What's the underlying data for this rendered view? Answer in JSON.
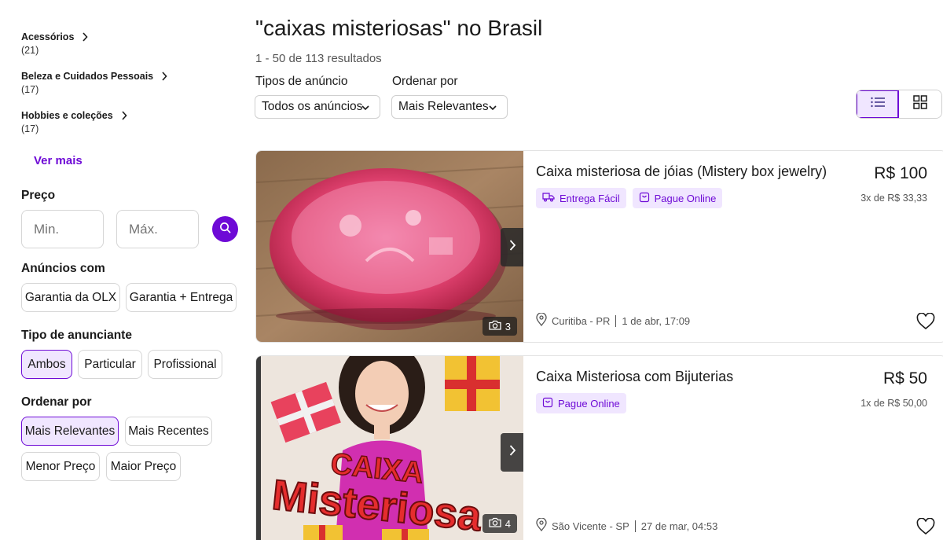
{
  "sidebar": {
    "categories": [
      {
        "name": "Acessórios",
        "count": "(21)"
      },
      {
        "name": "Beleza e Cuidados Pessoais",
        "count": "(17)"
      },
      {
        "name": "Hobbies e coleções",
        "count": "(17)"
      }
    ],
    "ver_mais": "Ver mais",
    "preco": {
      "title": "Preço",
      "min_placeholder": "Min.",
      "max_placeholder": "Máx."
    },
    "anuncios_com": {
      "title": "Anúncios com",
      "options": [
        "Garantia da OLX",
        "Garantia + Entrega"
      ]
    },
    "tipo_anunciante": {
      "title": "Tipo de anunciante",
      "options": [
        "Ambos",
        "Particular",
        "Profissional"
      ],
      "selected": "Ambos"
    },
    "ordenar": {
      "title": "Ordenar por",
      "options": [
        "Mais Relevantes",
        "Mais Recentes",
        "Menor Preço",
        "Maior Preço"
      ],
      "selected": "Mais Relevantes"
    }
  },
  "main": {
    "title": "\"caixas misteriosas\" no Brasil",
    "results": "1 - 50 de 113 resultados",
    "tipos_label": "Tipos de anúncio",
    "tipos_value": "Todos os anúncios",
    "ordenar_label": "Ordenar por",
    "ordenar_value": "Mais Relevantes",
    "view_mode": "list"
  },
  "listings": [
    {
      "title": "Caixa misteriosa de jóias (Mistery box jewelry)",
      "price": "R$ 100",
      "installments": "3x de R$ 33,33",
      "tags": [
        "Entrega Fácil",
        "Pague Online"
      ],
      "location": "Curitiba - PR",
      "date": "1 de abr, 17:09",
      "photos": "3"
    },
    {
      "title": "Caixa Misteriosa com Bijuterias",
      "price": "R$ 50",
      "installments": "1x de R$ 50,00",
      "tags": [
        "Pague Online"
      ],
      "location": "São Vicente - SP",
      "date": "27 de mar, 04:53",
      "photos": "4",
      "image_text": [
        "CAIXA",
        "Misteriosa"
      ]
    }
  ],
  "colors": {
    "accent": "#6e0ad6",
    "accent_light": "#f0e6ff",
    "border": "#d6d6d6"
  }
}
